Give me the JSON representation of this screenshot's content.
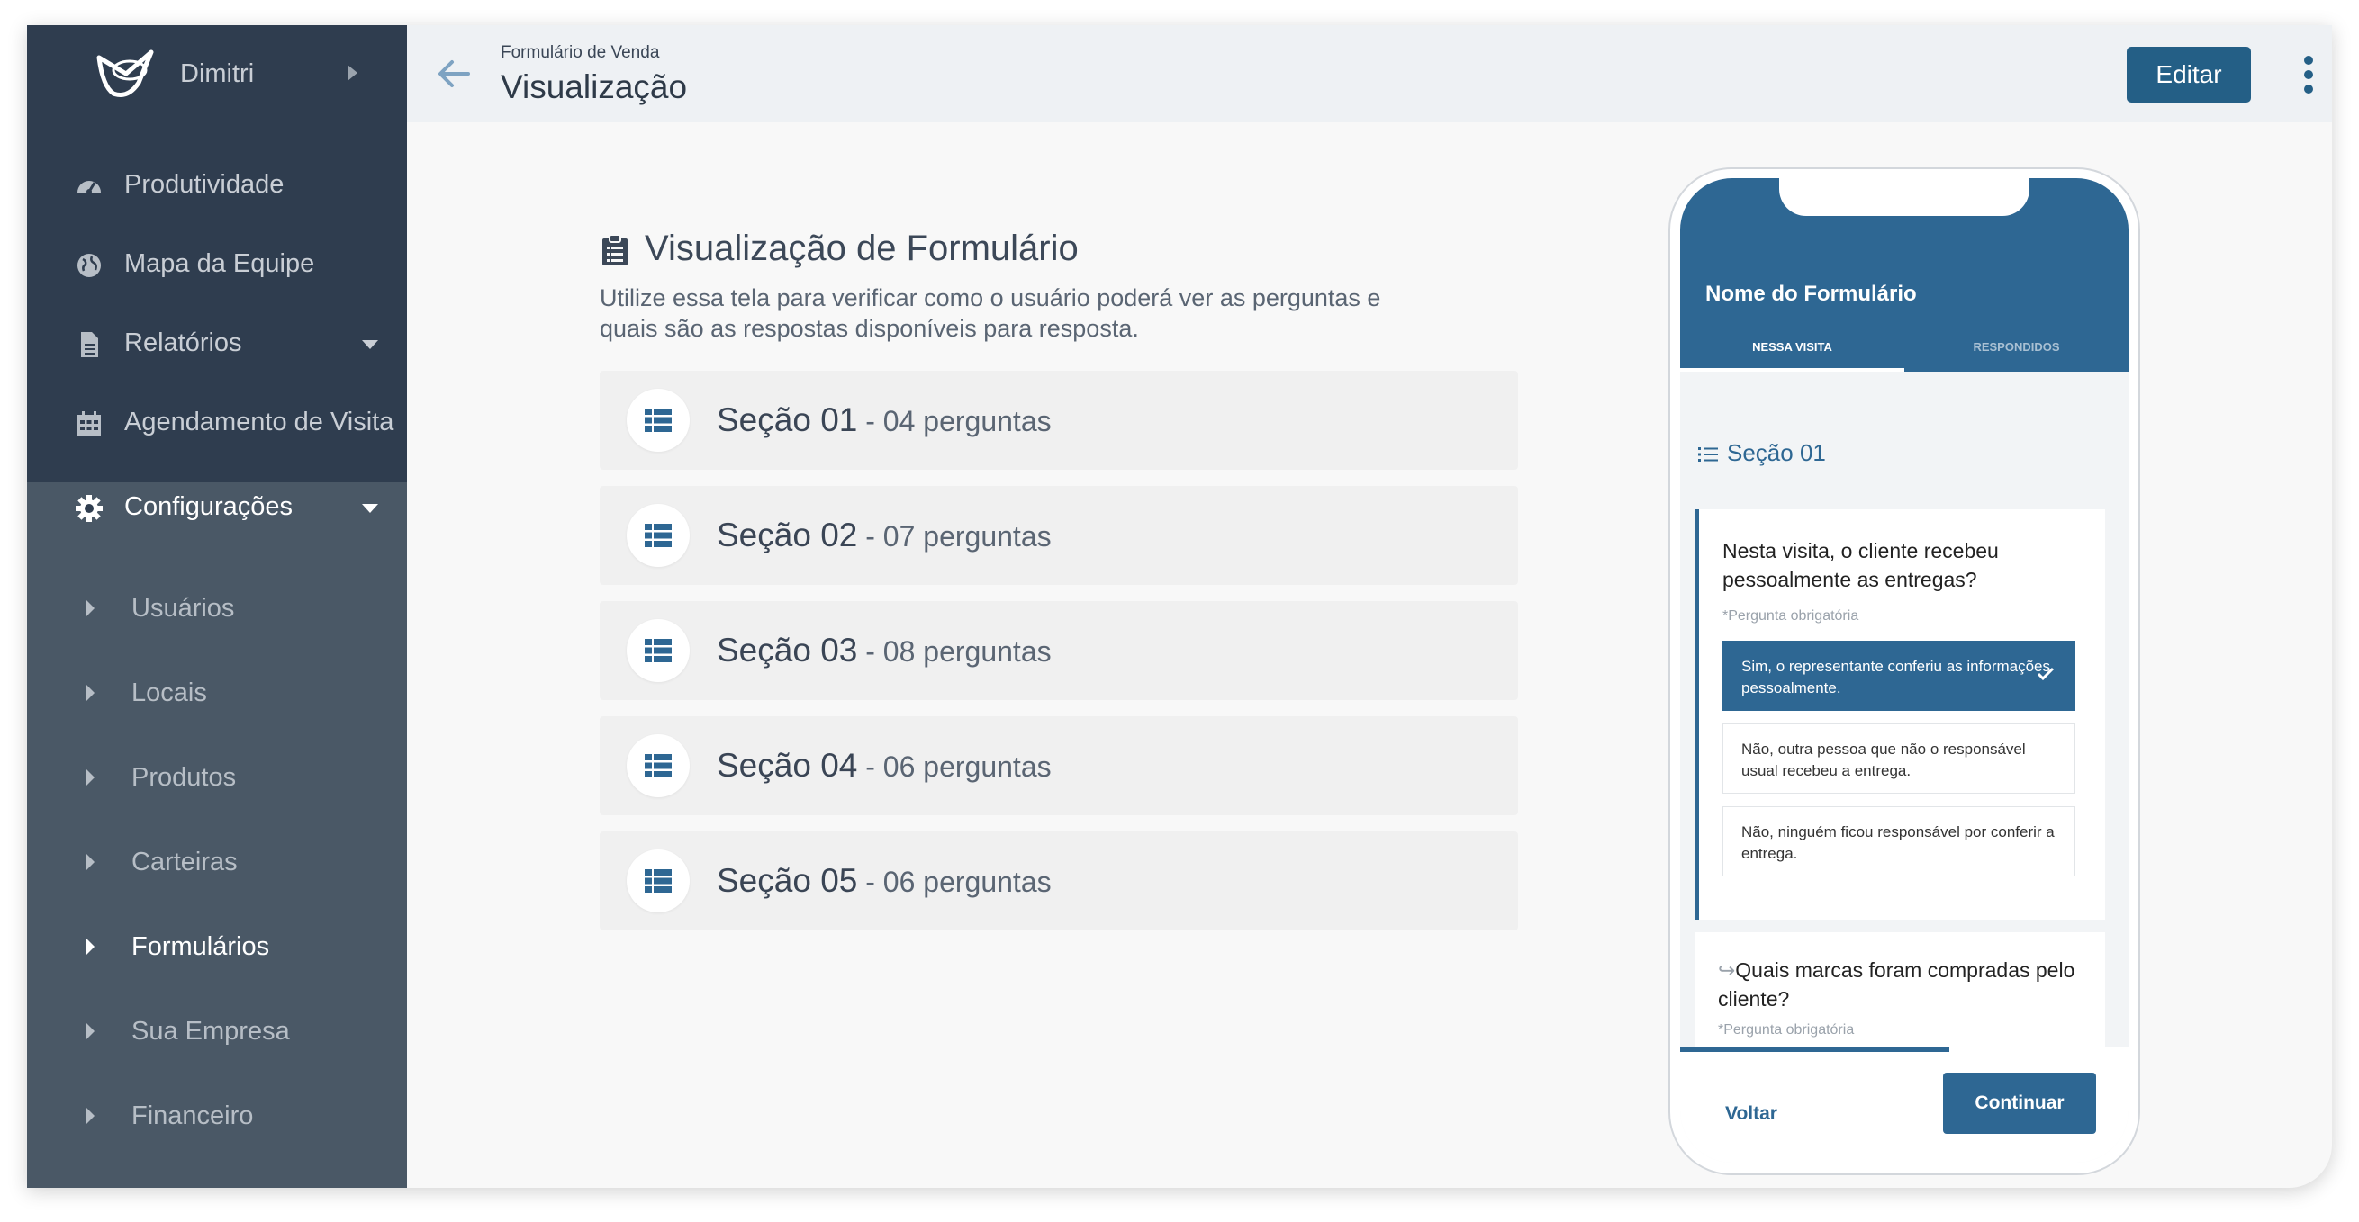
{
  "sidebar": {
    "user_name": "Dimitri",
    "nav": [
      {
        "label": "Produtividade",
        "icon": "speedometer-icon"
      },
      {
        "label": "Mapa da Equipe",
        "icon": "globe-icon"
      },
      {
        "label": "Relatórios",
        "icon": "document-icon"
      },
      {
        "label": "Agendamento de Visita",
        "icon": "calendar-icon"
      },
      {
        "label": "Configurações",
        "icon": "gear-icon"
      }
    ],
    "sub_items": [
      "Usuários",
      "Locais",
      "Produtos",
      "Carteiras",
      "Formulários",
      "Sua Empresa",
      "Financeiro"
    ],
    "active_sub": "Formulários"
  },
  "header": {
    "breadcrumb": "Formulário de Venda",
    "title": "Visualização",
    "edit_label": "Editar"
  },
  "main": {
    "title": "Visualização de Formulário",
    "description": "Utilize essa tela para verificar como o usuário poderá ver as perguntas e quais são as respostas disponíveis para resposta.",
    "sections": [
      {
        "name": "Seção 01",
        "count": " - 04 perguntas"
      },
      {
        "name": "Seção 02",
        "count": " - 07 perguntas"
      },
      {
        "name": "Seção 03",
        "count": " - 08 perguntas"
      },
      {
        "name": "Seção 04",
        "count": " - 06 perguntas"
      },
      {
        "name": "Seção 05",
        "count": " - 06 perguntas"
      }
    ]
  },
  "preview": {
    "form_name": "Nome do Formulário",
    "tabs": [
      "NESSA VISITA",
      "RESPONDIDOS"
    ],
    "section": "Seção 01",
    "question1": "Nesta visita, o cliente recebeu pessoalmente as entregas?",
    "required": "*Pergunta obrigatória",
    "options": [
      "Sim, o representante conferiu as informações pessoalmente.",
      "Não, outra pessoa que não o responsável usual recebeu a entrega.",
      "Não, ninguém ficou responsável por conferir a entrega."
    ],
    "question2_prefix": "↪",
    "question2": "Quais marcas foram compradas pelo cliente?",
    "back_label": "Voltar",
    "continue_label": "Continuar",
    "progress": 0.6
  },
  "colors": {
    "primary": "#245f86",
    "sidebar": "#2f3d4f",
    "sidebar_sub": "#4a5866"
  }
}
